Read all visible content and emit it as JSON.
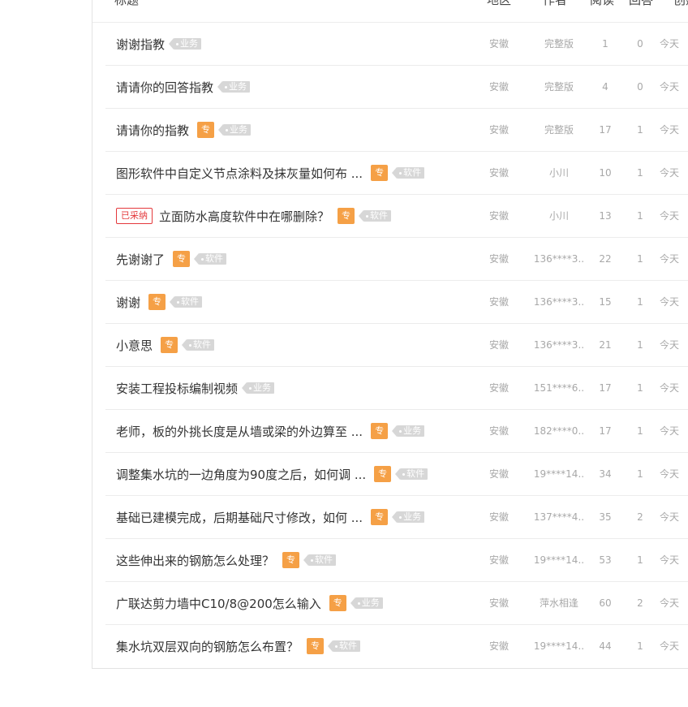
{
  "header": {
    "title": "标题",
    "region": "地区",
    "author": "作者",
    "reads": "阅读",
    "answers": "回答",
    "created": "创建"
  },
  "rows": [
    {
      "adopted": "",
      "title": "谢谢指教",
      "zhuan": "",
      "tag": "业务",
      "region": "安徽",
      "author": "完整版",
      "reads": "1",
      "answers": "0",
      "date": "今天"
    },
    {
      "adopted": "",
      "title": "请请你的回答指教",
      "zhuan": "",
      "tag": "业务",
      "region": "安徽",
      "author": "完整版",
      "reads": "4",
      "answers": "0",
      "date": "今天"
    },
    {
      "adopted": "",
      "title": "请请你的指教",
      "zhuan": "专",
      "tag": "业务",
      "region": "安徽",
      "author": "完整版",
      "reads": "17",
      "answers": "1",
      "date": "今天"
    },
    {
      "adopted": "",
      "title": "图形软件中自定义节点涂料及抹灰量如何布 ...",
      "zhuan": "专",
      "tag": "软件",
      "region": "安徽",
      "author": "小川",
      "reads": "10",
      "answers": "1",
      "date": "今天"
    },
    {
      "adopted": "已采纳",
      "title": "立面防水高度软件中在哪删除？",
      "zhuan": "专",
      "tag": "软件",
      "region": "安徽",
      "author": "小川",
      "reads": "13",
      "answers": "1",
      "date": "今天"
    },
    {
      "adopted": "",
      "title": "先谢谢了",
      "zhuan": "专",
      "tag": "软件",
      "region": "安徽",
      "author": "136****3..",
      "reads": "22",
      "answers": "1",
      "date": "今天"
    },
    {
      "adopted": "",
      "title": "谢谢",
      "zhuan": "专",
      "tag": "软件",
      "region": "安徽",
      "author": "136****3..",
      "reads": "15",
      "answers": "1",
      "date": "今天"
    },
    {
      "adopted": "",
      "title": "小意思",
      "zhuan": "专",
      "tag": "软件",
      "region": "安徽",
      "author": "136****3..",
      "reads": "21",
      "answers": "1",
      "date": "今天"
    },
    {
      "adopted": "",
      "title": "安装工程投标编制视频",
      "zhuan": "",
      "tag": "业务",
      "region": "安徽",
      "author": "151****6..",
      "reads": "17",
      "answers": "1",
      "date": "今天"
    },
    {
      "adopted": "",
      "title": "老师，板的外挑长度是从墙或梁的外边算至 ...",
      "zhuan": "专",
      "tag": "业务",
      "region": "安徽",
      "author": "182****0..",
      "reads": "17",
      "answers": "1",
      "date": "今天"
    },
    {
      "adopted": "",
      "title": "调整集水坑的一边角度为90度之后，如何调 ...",
      "zhuan": "专",
      "tag": "软件",
      "region": "安徽",
      "author": "19****14..",
      "reads": "34",
      "answers": "1",
      "date": "今天"
    },
    {
      "adopted": "",
      "title": "基础已建模完成，后期基础尺寸修改，如何 ...",
      "zhuan": "专",
      "tag": "业务",
      "region": "安徽",
      "author": "137****4..",
      "reads": "35",
      "answers": "2",
      "date": "今天"
    },
    {
      "adopted": "",
      "title": "这些伸出来的钢筋怎么处理？",
      "zhuan": "专",
      "tag": "软件",
      "region": "安徽",
      "author": "19****14..",
      "reads": "53",
      "answers": "1",
      "date": "今天"
    },
    {
      "adopted": "",
      "title": "广联达剪力墙中C10/8@200怎么输入",
      "zhuan": "专",
      "tag": "业务",
      "region": "安徽",
      "author": "萍水相逢",
      "reads": "60",
      "answers": "2",
      "date": "今天"
    },
    {
      "adopted": "",
      "title": "集水坑双层双向的钢筋怎么布置？",
      "zhuan": "专",
      "tag": "软件",
      "region": "安徽",
      "author": "19****14..",
      "reads": "44",
      "answers": "1",
      "date": "今天"
    }
  ]
}
